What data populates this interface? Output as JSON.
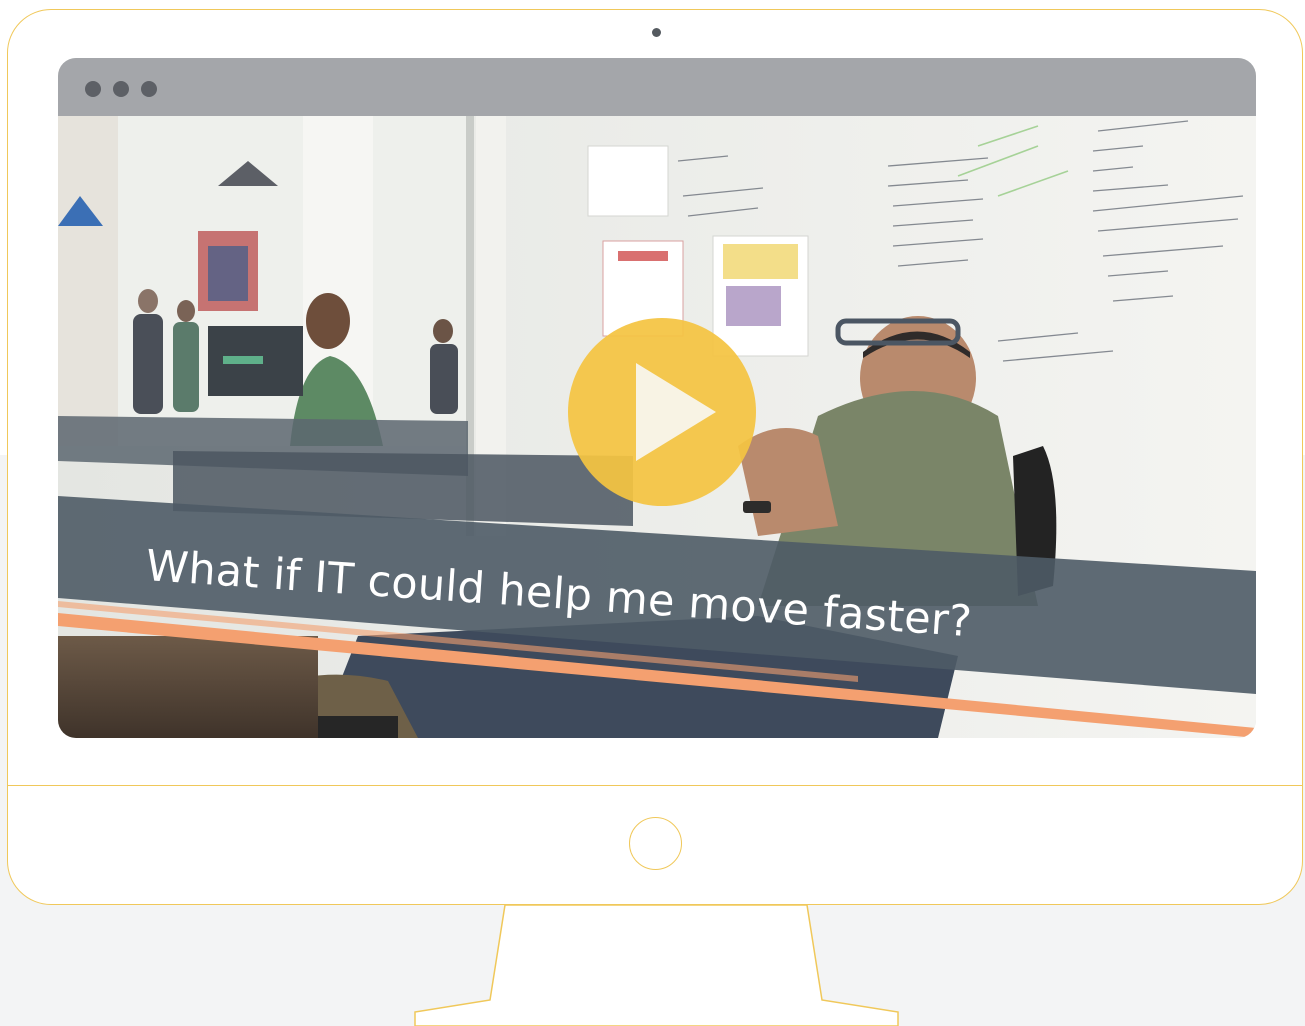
{
  "video": {
    "caption": "What if IT could help me move faster?",
    "play_button_icon": "play-icon"
  },
  "window": {
    "titlebar_dots": [
      "dot",
      "dot",
      "dot"
    ]
  },
  "colors": {
    "monitor_outline": "#f0c85a",
    "play_button": "#f4c442",
    "caption_band": "#4e5b66",
    "accent_stripe": "#f4a070",
    "titlebar": "#a4a6aa"
  }
}
